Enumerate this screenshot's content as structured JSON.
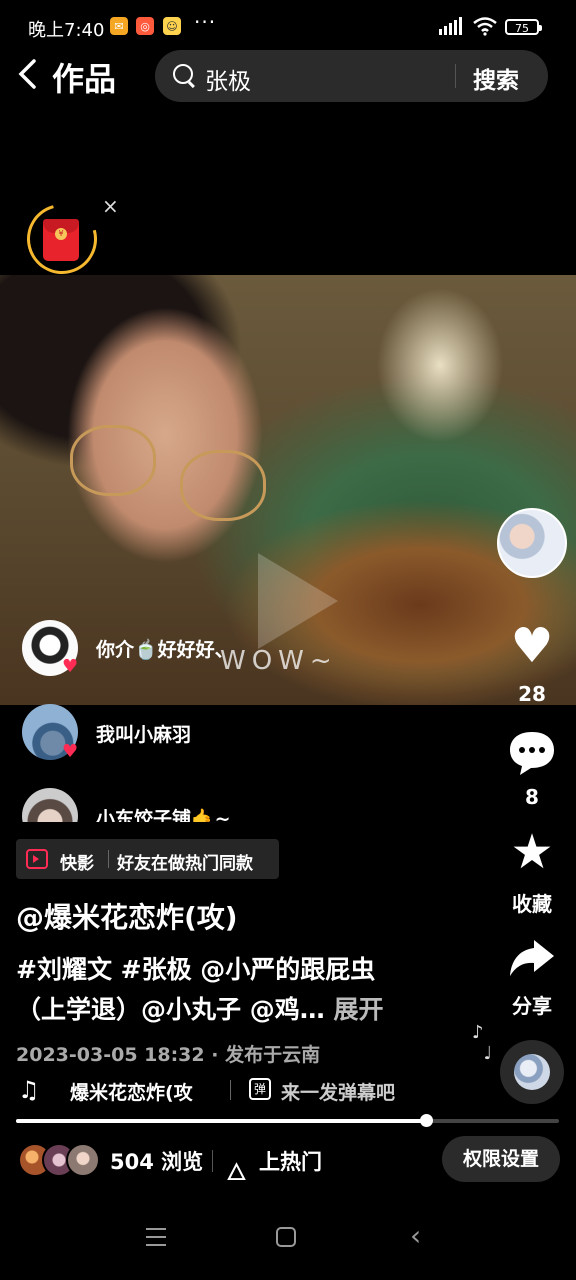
{
  "status_bar": {
    "time": "晚上7:40",
    "more": "···",
    "battery": "75"
  },
  "header": {
    "back_icon": "chevron-left-icon",
    "title": "作品",
    "search_query": "张极",
    "search_button": "搜索"
  },
  "red_packet": {
    "close": "×"
  },
  "video": {
    "overlay_text": "WOW~"
  },
  "danmaku": [
    {
      "name": "你介🍵好好好",
      "suffix": "、"
    },
    {
      "name": "我叫小麻羽"
    },
    {
      "name": "小东饺子铺🤙~"
    }
  ],
  "rail": {
    "likes": "28",
    "comments": "8",
    "favorite_label": "收藏",
    "share_label": "分享"
  },
  "post": {
    "kuaiying_label": "快影",
    "kuaiying_hint": "好友在做热门同款",
    "author": "@爆米花恋炸(攻)",
    "desc_line1": "#刘耀文 #张极 @小严的跟屁虫",
    "desc_line2": "（上学退）@小丸子 @鸡…",
    "expand": "展开",
    "meta": "2023-03-05 18:32 · 发布于云南",
    "music": "爆米花恋炸(攻",
    "danmaku_prompt": "来一发弹幕吧",
    "danmaku_icon_text": "弹"
  },
  "footer": {
    "views": "504 浏览",
    "hot": "上热门",
    "permission": "权限设置"
  },
  "progress": {
    "played_fraction": 0.755
  },
  "colors": {
    "accent": "#fe2c55",
    "packet": "#e8232b",
    "ring": "#f5b82e"
  }
}
